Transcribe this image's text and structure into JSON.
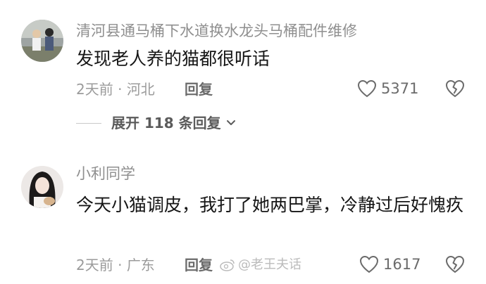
{
  "comments": [
    {
      "username": "清河县通马桶下水道换水龙头马桶配件维修",
      "content": "发现老人养的猫都很听话",
      "time": "2天前",
      "location": "河北",
      "reply_label": "回复",
      "like_count": "5371",
      "expand_label": "展开 118 条回复",
      "like_icon": "heart-outline-icon",
      "dislike_icon": "broken-heart-icon"
    },
    {
      "username": "小利同学",
      "content": "今天小猫调皮，我打了她两巴掌，冷静过后好愧疚",
      "time": "2天前",
      "location": "广东",
      "reply_label": "回复",
      "like_count": "1617",
      "like_icon": "heart-outline-icon",
      "dislike_icon": "broken-heart-icon"
    }
  ],
  "watermark": "@老王夫话",
  "meta_separator": "·"
}
